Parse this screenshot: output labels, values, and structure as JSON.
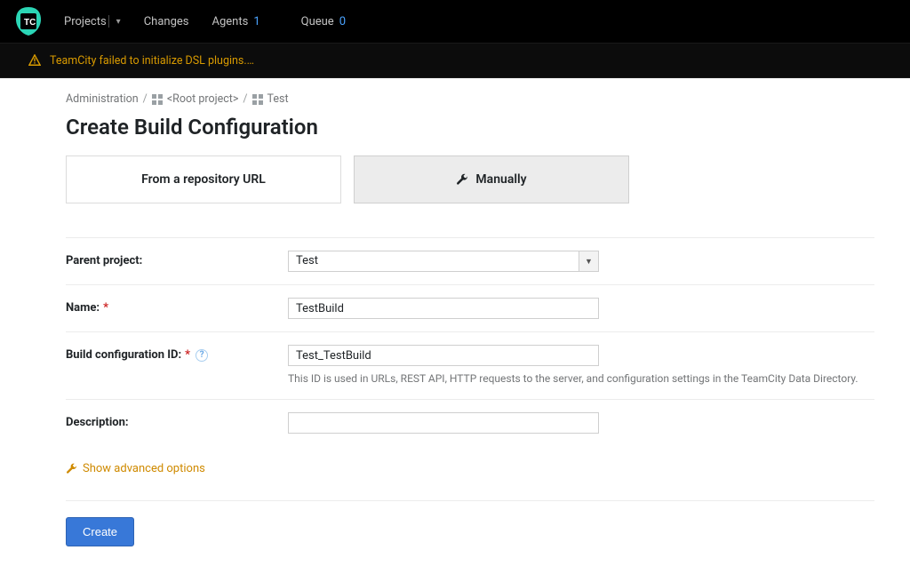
{
  "nav": {
    "projects": "Projects",
    "changes": "Changes",
    "agents": "Agents",
    "agents_count": "1",
    "queue": "Queue",
    "queue_count": "0"
  },
  "warning": "TeamCity failed to initialize DSL plugins.…",
  "breadcrumb": {
    "admin": "Administration",
    "root": "<Root project>",
    "project": "Test"
  },
  "page_title": "Create Build Configuration",
  "tabs": {
    "repo": "From a repository URL",
    "manual": "Manually"
  },
  "form": {
    "parent_project_label": "Parent project:",
    "parent_project_value": "Test",
    "name_label": "Name:",
    "name_value": "TestBuild",
    "config_id_label": "Build configuration ID:",
    "config_id_value": "Test_TestBuild",
    "config_id_hint": "This ID is used in URLs, REST API, HTTP requests to the server, and configuration settings in the TeamCity Data Directory.",
    "description_label": "Description:",
    "description_value": ""
  },
  "advanced_toggle": "Show advanced options",
  "create_button": "Create"
}
